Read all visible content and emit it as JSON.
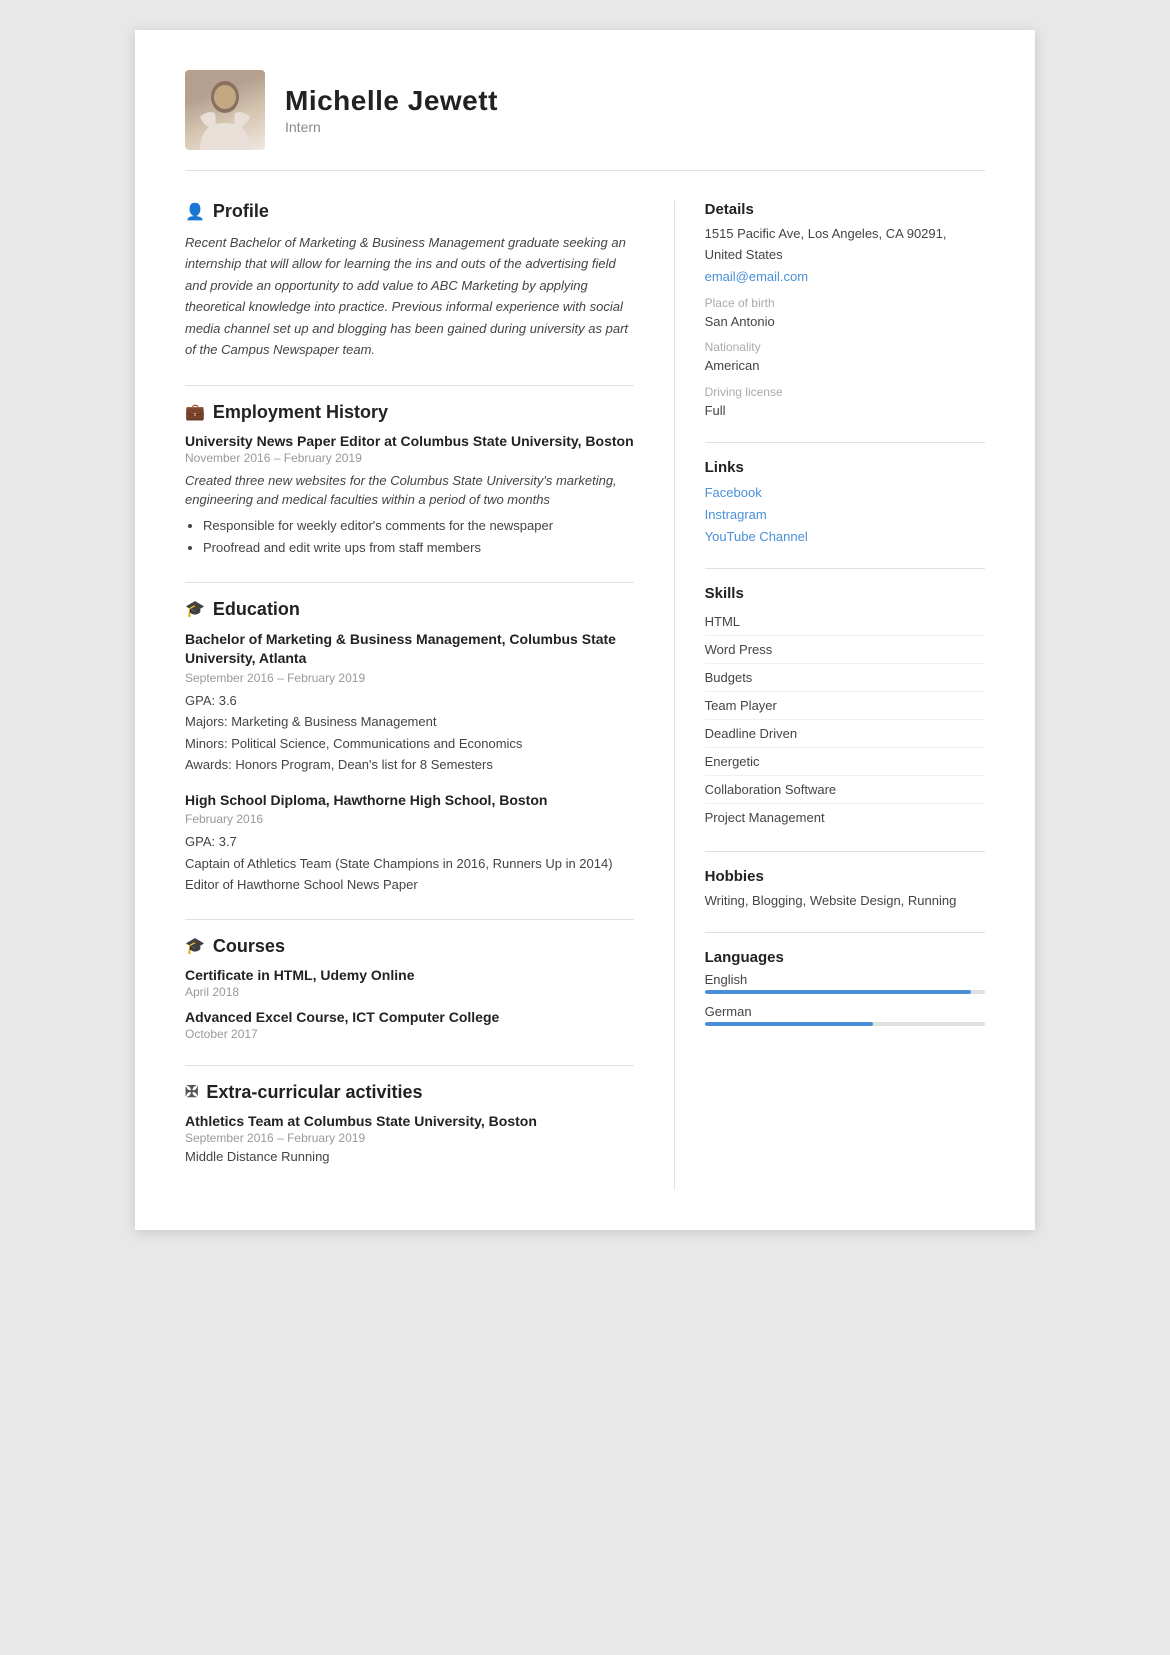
{
  "header": {
    "name": "Michelle Jewett",
    "subtitle": "Intern"
  },
  "profile": {
    "section_title": "Profile",
    "text": "Recent Bachelor of Marketing & Business Management graduate seeking an internship that will allow for learning the ins and outs of the advertising field and provide an opportunity to add value to ABC Marketing by applying theoretical knowledge into practice. Previous informal experience with social media channel set up and blogging has been gained during university as part of the Campus Newspaper team."
  },
  "employment": {
    "section_title": "Employment History",
    "jobs": [
      {
        "title": "University News Paper Editor at Columbus State University, Boston",
        "date": "November 2016 – February 2019",
        "description": "Created three new websites for the Columbus State University's marketing, engineering and medical faculties within a period of two months",
        "bullets": [
          "Responsible for weekly editor's comments for the newspaper",
          "Proofread and edit write ups from staff members"
        ]
      }
    ]
  },
  "education": {
    "section_title": "Education",
    "items": [
      {
        "title": "Bachelor of Marketing & Business Management, Columbus State University, Atlanta",
        "date": "September 2016 – February 2019",
        "details": [
          "GPA: 3.6",
          "Majors: Marketing & Business Management",
          "Minors: Political Science, Communications and Economics",
          "Awards: Honors Program, Dean's list for 8 Semesters"
        ]
      },
      {
        "title": "High School Diploma, Hawthorne High School, Boston",
        "date": "February 2016",
        "details": [
          "GPA: 3.7",
          "Captain of Athletics Team (State Champions in 2016, Runners Up in 2014)",
          "Editor of Hawthorne School News Paper"
        ]
      }
    ]
  },
  "courses": {
    "section_title": "Courses",
    "items": [
      {
        "title": "Certificate in HTML, Udemy Online",
        "date": "April 2018"
      },
      {
        "title": "Advanced Excel Course, ICT Computer College",
        "date": "October 2017"
      }
    ]
  },
  "extracurricular": {
    "section_title": "Extra-curricular activities",
    "items": [
      {
        "title": "Athletics Team at Columbus State University, Boston",
        "date": "September 2016 – February 2019",
        "detail": "Middle Distance Running"
      }
    ]
  },
  "details": {
    "heading": "Details",
    "address": "1515 Pacific Ave, Los Angeles, CA 90291, United States",
    "email": "email@email.com",
    "place_of_birth_label": "Place of birth",
    "place_of_birth": "San Antonio",
    "nationality_label": "Nationality",
    "nationality": "American",
    "driving_label": "Driving license",
    "driving": "Full"
  },
  "links": {
    "heading": "Links",
    "items": [
      {
        "label": "Facebook",
        "href": "#"
      },
      {
        "label": "Instragram",
        "href": "#"
      },
      {
        "label": "YouTube Channel",
        "href": "#"
      }
    ]
  },
  "skills": {
    "heading": "Skills",
    "items": [
      "HTML",
      "Word Press",
      "Budgets",
      "Team Player",
      "Deadline Driven",
      "Energetic",
      "Collaboration Software",
      "Project Management"
    ]
  },
  "hobbies": {
    "heading": "Hobbies",
    "text": "Writing, Blogging, Website Design, Running"
  },
  "languages": {
    "heading": "Languages",
    "items": [
      {
        "name": "English",
        "level": 95
      },
      {
        "name": "German",
        "level": 60
      }
    ]
  }
}
